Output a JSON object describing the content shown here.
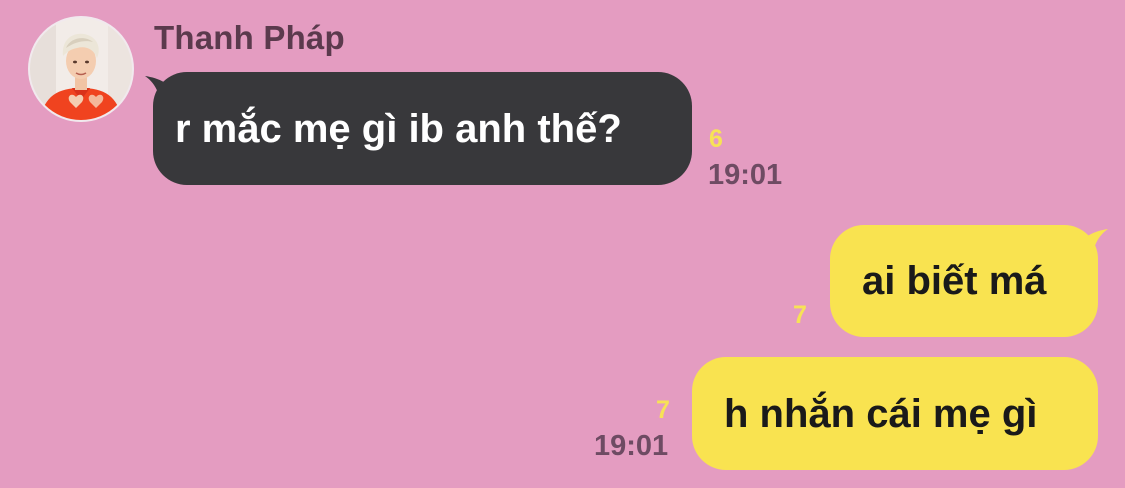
{
  "conversation": {
    "sender_name": "Thanh Pháp",
    "messages": [
      {
        "direction": "incoming",
        "text": "r mắc mẹ gì ib anh thế?",
        "read_count": "6",
        "time": "19:01"
      },
      {
        "direction": "outgoing",
        "text": "ai biết má",
        "read_count": "7",
        "time": ""
      },
      {
        "direction": "outgoing",
        "text": "h nhắn cái mẹ gì",
        "read_count": "7",
        "time": "19:01"
      }
    ]
  },
  "icons": {
    "avatar": "profile-photo"
  },
  "colors": {
    "background": "#e49cc1",
    "incoming_bubble": "#38383b",
    "outgoing_bubble": "#f9e350",
    "read_count": "#f7e256",
    "timestamp": "#6e4b63",
    "sender_name": "#5b3a4d"
  }
}
